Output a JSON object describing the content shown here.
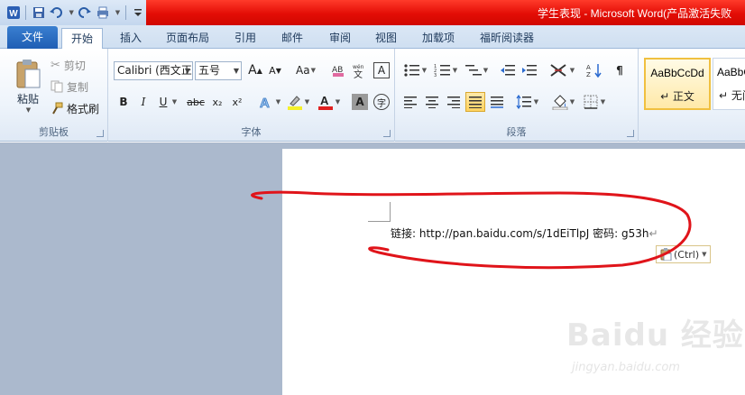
{
  "titlebar": {
    "title": "学生表现 - Microsoft Word(产品激活失败",
    "qat": [
      "word-app-icon",
      "save-icon",
      "undo-icon",
      "redo-icon",
      "print-icon",
      "customize-icon"
    ]
  },
  "tabs": [
    {
      "label": "文件"
    },
    {
      "label": "开始"
    },
    {
      "label": "插入"
    },
    {
      "label": "页面布局"
    },
    {
      "label": "引用"
    },
    {
      "label": "邮件"
    },
    {
      "label": "审阅"
    },
    {
      "label": "视图"
    },
    {
      "label": "加载项"
    },
    {
      "label": "福昕阅读器"
    }
  ],
  "clipboard": {
    "paste": "粘贴",
    "cut": "剪切",
    "copy": "复制",
    "format_painter": "格式刷",
    "label": "剪贴板"
  },
  "font": {
    "name": "Calibri (西文正",
    "size": "五号",
    "label": "字体",
    "bold": "B",
    "italic": "I",
    "underline": "U",
    "strike": "abc",
    "subscript": "x₂",
    "superscript": "x²",
    "grow": "A",
    "shrink": "A",
    "case": "Aa",
    "text_color": "#e02020",
    "highlight_color": "#f5f02a"
  },
  "paragraph": {
    "label": "段落"
  },
  "styles": {
    "items": [
      {
        "sample": "AaBbCcDd",
        "name": "↵ 正文"
      },
      {
        "sample": "AaBbC",
        "name": "↵ 无间"
      }
    ]
  },
  "document": {
    "text": "链接: http://pan.baidu.com/s/1dEiTlpJ  密码: g53h",
    "paste_ctrl": "(Ctrl)"
  },
  "watermark": {
    "logo": "Baidu 经验",
    "url": "jingyan.baidu.com"
  }
}
